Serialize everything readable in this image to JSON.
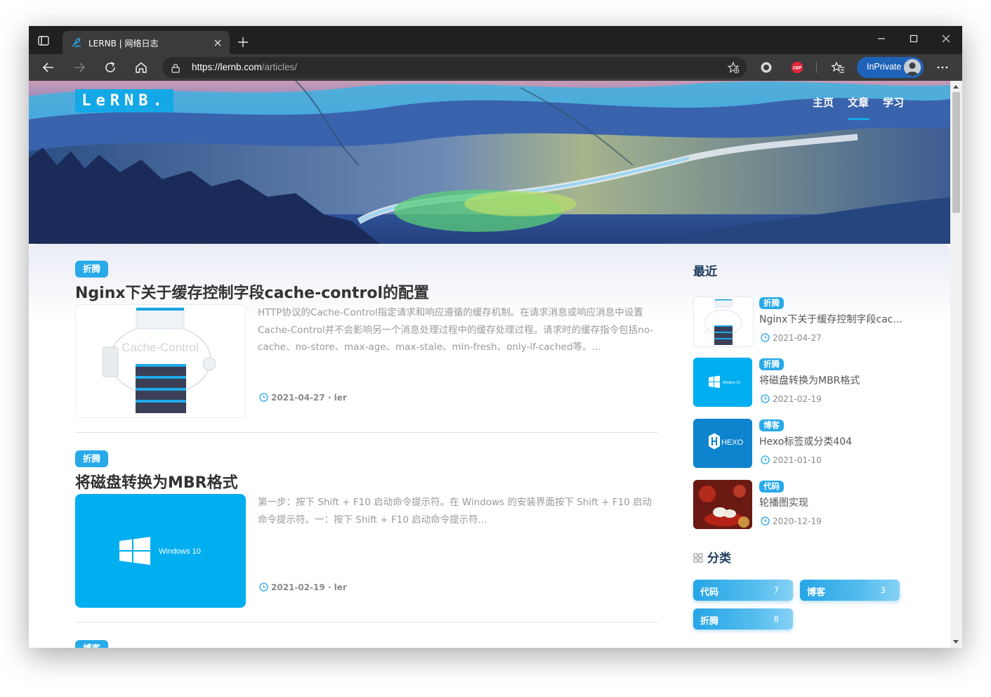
{
  "browser": {
    "tab_title": "LERNB | 网络日志",
    "url_host": "https://lernb.com",
    "url_path": "/articles/",
    "inprivate_label": "InPrivate",
    "extension_badge": "ABP"
  },
  "site": {
    "logo_text": "LeRNB.",
    "nav": [
      "主页",
      "文章",
      "学习"
    ],
    "active_nav": "文章",
    "accent_color": "#28a9e8"
  },
  "articles": [
    {
      "tag": "折腾",
      "title": "Nginx下关于缓存控制字段cache-control的配置",
      "thumb_text": "Cache-Control",
      "excerpt": "HTTP协议的Cache-Control指定请求和响应遵循的缓存机制。在请求消息或响应消息中设置Cache-Control并不会影响另一个消息处理过程中的缓存处理过程。请求时的缓存指令包括no-cache、no-store、max-age、max-stale、min-fresh、only-if-cached等。...",
      "meta": "2021-04-27 · ler"
    },
    {
      "tag": "折腾",
      "title": "将磁盘转换为MBR格式",
      "thumb_text": "Windows 10",
      "excerpt": "第一步：按下 Shift + F10 启动命令提示符。在 Windows 的安装界面按下 Shift + F10 启动命令提示符。一：按下 Shift + F10 启动命令提示符...",
      "meta": "2021-02-19 · ler"
    },
    {
      "tag": "博客"
    }
  ],
  "sidebar": {
    "recent_heading": "最近",
    "recent": [
      {
        "tag": "折腾",
        "title": "Nginx下关于缓存控制字段cac...",
        "date": "2021-04-27"
      },
      {
        "tag": "折腾",
        "title": "将磁盘转换为MBR格式",
        "date": "2021-02-19",
        "thumb_text": "Window 10"
      },
      {
        "tag": "博客",
        "title": "Hexo标签或分类404",
        "date": "2021-01-10",
        "thumb_text": "HEXO"
      },
      {
        "tag": "代码",
        "title": "轮播图实现",
        "date": "2020-12-19"
      }
    ],
    "categories_heading": "分类",
    "categories": [
      {
        "name": "代码",
        "count": "7"
      },
      {
        "name": "博客",
        "count": "3"
      },
      {
        "name": "折腾",
        "count": "8"
      }
    ]
  }
}
